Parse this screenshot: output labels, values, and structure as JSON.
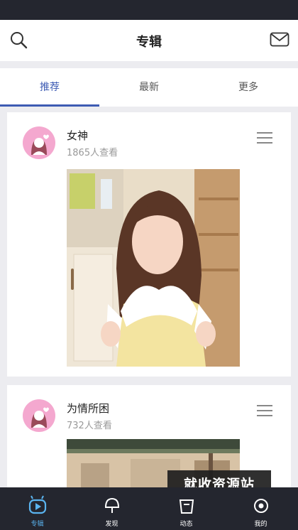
{
  "header": {
    "title": "专辑",
    "search_icon": "search-icon",
    "mail_icon": "mail-icon"
  },
  "tabs": [
    {
      "label": "推荐",
      "active": true
    },
    {
      "label": "最新",
      "active": false
    },
    {
      "label": "更多",
      "active": false
    }
  ],
  "albums": [
    {
      "author": "女神",
      "views": "1865人查看"
    },
    {
      "author": "为情所困",
      "views": "732人查看"
    }
  ],
  "bottom_nav": [
    {
      "label": "专辑",
      "icon": "album-icon",
      "active": true
    },
    {
      "label": "发现",
      "icon": "discover-icon",
      "active": false
    },
    {
      "label": "动态",
      "icon": "feed-icon",
      "active": false
    },
    {
      "label": "我的",
      "icon": "profile-icon",
      "active": false
    }
  ],
  "watermark": "就收资源站",
  "colors": {
    "accent": "#3d5bb3",
    "avatar_bg": "#f4a8cf",
    "nav_bg": "#24262f",
    "nav_active": "#5ab4f0"
  }
}
